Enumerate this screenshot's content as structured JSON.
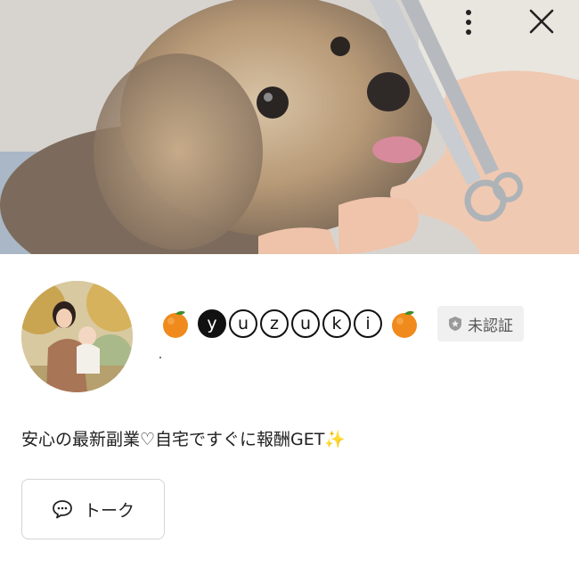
{
  "profile": {
    "name_prefix_emoji": "orange-icon",
    "name_letters": [
      "y",
      "u",
      "z",
      "u",
      "k",
      "i"
    ],
    "name_suffix_emoji": "orange-icon",
    "verification_label": "未認証",
    "status_message": "安心の最新副業♡自宅ですぐに報酬GET✨"
  },
  "actions": {
    "talk_label": "トーク"
  },
  "colors": {
    "badge_bg": "#f0f0f0",
    "button_border": "#d4d4d4",
    "text": "#222222"
  }
}
